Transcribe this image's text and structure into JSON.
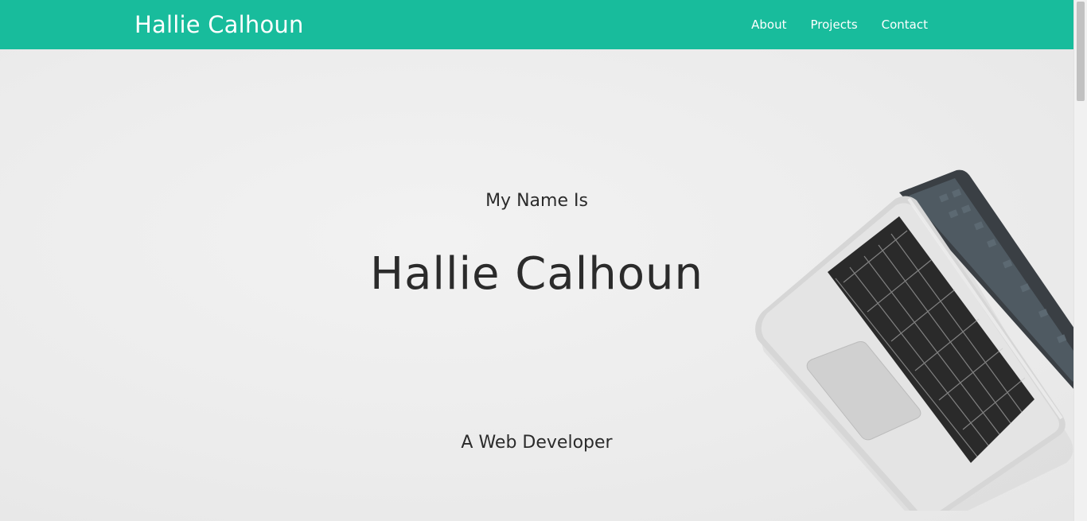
{
  "navbar": {
    "brand": "Hallie Calhoun",
    "links": [
      {
        "label": "About"
      },
      {
        "label": "Projects"
      },
      {
        "label": "Contact"
      }
    ],
    "background_color": "#18bc9c"
  },
  "hero": {
    "subtitle": "My Name Is",
    "name": "Hallie Calhoun",
    "role": "A Web Developer",
    "image": "laptop-photo"
  }
}
